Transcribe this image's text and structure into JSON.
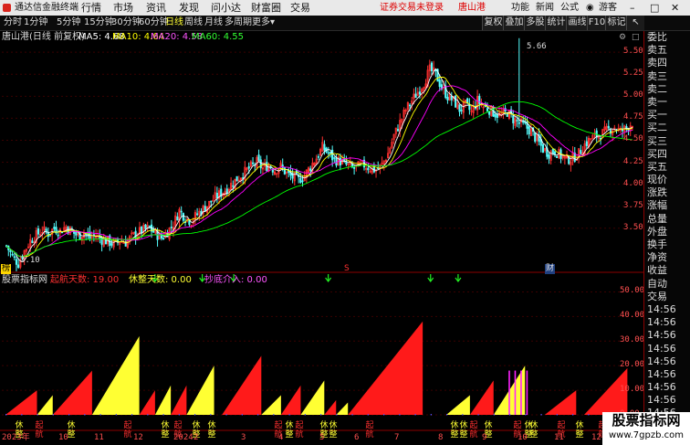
{
  "titlebar": {
    "app_name": "通达信金融终端",
    "menus": [
      "行情",
      "市场",
      "资讯",
      "发现",
      "问小达",
      "财富圈",
      "交易"
    ],
    "notice": "证券交易未登录",
    "stock_name": "唐山港",
    "right": [
      "功能",
      "新闻",
      "公式"
    ],
    "guest": "游客"
  },
  "toolbar": {
    "periods": [
      "分时",
      "1分钟",
      "5分钟",
      "15分钟",
      "30分钟",
      "60分钟",
      "日线",
      "周线",
      "月线",
      "多周期",
      "更多"
    ],
    "active_period": "日线",
    "right_buttons": [
      "复权",
      "叠加",
      "多股",
      "统计",
      "画线",
      "F10",
      "标记"
    ]
  },
  "main_legend": {
    "title": "唐山港(日线 前复权)",
    "ma5": "MA5: 4.68",
    "ma10": "MA10: 4.64",
    "ma20": "MA20: 4.58",
    "ma60": "MA60: 4.55"
  },
  "colors": {
    "ma5": "#ffffff",
    "ma10": "#ffff00",
    "ma20": "#ff00ff",
    "ma60": "#00ff00",
    "up": "#ff3030",
    "down": "#54ffff",
    "indicator_red": "#ff1a1a",
    "indicator_yellow": "#ffff33"
  },
  "price_axis": {
    "labels": [
      "5.50",
      "5.25",
      "5.00",
      "4.75",
      "4.50",
      "4.25",
      "4.00",
      "3.75",
      "3.50"
    ],
    "min": 3.02,
    "max": 5.72
  },
  "markers": {
    "high": "5.66",
    "low": "3.10",
    "s_tag": "S",
    "cai": "财",
    "left_tag": "榜"
  },
  "sub_legend": {
    "name": "股票指标网",
    "qihang": "起航天数: 19.00",
    "xiupan": "休整天数: 0.00",
    "chaodi": "抄底介入: 0.00"
  },
  "sub_axis": {
    "labels": [
      "50.00",
      "40.00",
      "30.00",
      "20.00",
      "10.00",
      "0.00"
    ],
    "min": 0,
    "max": 55
  },
  "right_panel": [
    "委比",
    "卖五",
    "卖四",
    "卖三",
    "卖二",
    "卖一",
    "买一",
    "买二",
    "买三",
    "买四",
    "买五",
    "现价",
    "涨跌",
    "涨幅",
    "总量",
    "外盘",
    "换手",
    "净资",
    "收益",
    "自动",
    "交易",
    "14:56",
    "14:56",
    "14:56",
    "14:56",
    "14:56",
    "14:56",
    "14:56",
    "14:56",
    "14:56",
    "14:56"
  ],
  "date_axis": [
    "2023年",
    "10",
    "11",
    "12",
    "2024",
    "2",
    "3",
    "4",
    "5",
    "6",
    "7",
    "8",
    "9",
    "10",
    "11",
    "12"
  ],
  "watermark": "股票指标网",
  "watermark_url": "www.7gpzb.com",
  "bottom_labels": [
    {
      "t": "休整",
      "c": "yellow"
    },
    {
      "t": "起航",
      "c": "red"
    },
    {
      "t": "休整",
      "c": "yellow"
    },
    {
      "t": "起航",
      "c": "red"
    },
    {
      "t": "休整",
      "c": "yellow"
    },
    {
      "t": "起航",
      "c": "red"
    },
    {
      "t": "休整",
      "c": "yellow"
    },
    {
      "t": "休整",
      "c": "yellow"
    },
    {
      "t": "起航",
      "c": "red"
    },
    {
      "t": "休整",
      "c": "yellow"
    },
    {
      "t": "起航",
      "c": "red"
    },
    {
      "t": "休整",
      "c": "yellow"
    },
    {
      "t": "休整",
      "c": "yellow"
    },
    {
      "t": "起航",
      "c": "red"
    },
    {
      "t": "休整",
      "c": "yellow"
    },
    {
      "t": "休整",
      "c": "yellow"
    },
    {
      "t": "起航",
      "c": "red"
    },
    {
      "t": "休整",
      "c": "yellow"
    },
    {
      "t": "起航",
      "c": "red"
    },
    {
      "t": "休整",
      "c": "yellow"
    },
    {
      "t": "休整",
      "c": "yellow"
    },
    {
      "t": "起航",
      "c": "red"
    },
    {
      "t": "休整",
      "c": "yellow"
    },
    {
      "t": "起航",
      "c": "red"
    }
  ],
  "chart_data": {
    "type": "candlestick+indicator",
    "close": [
      3.3,
      3.18,
      3.1,
      3.24,
      3.36,
      3.42,
      3.48,
      3.44,
      3.5,
      3.47,
      3.52,
      3.46,
      3.41,
      3.45,
      3.39,
      3.42,
      3.37,
      3.35,
      3.32,
      3.36,
      3.34,
      3.4,
      3.45,
      3.48,
      3.5,
      3.44,
      3.39,
      3.46,
      3.55,
      3.7,
      3.62,
      3.58,
      3.66,
      3.72,
      3.78,
      3.85,
      3.9,
      3.95,
      4.02,
      4.08,
      4.14,
      4.2,
      4.25,
      4.18,
      4.22,
      4.16,
      4.2,
      4.12,
      4.08,
      4.05,
      4.1,
      4.2,
      4.3,
      4.42,
      4.35,
      4.28,
      4.26,
      4.22,
      4.18,
      4.2,
      4.22,
      4.18,
      4.16,
      4.22,
      4.35,
      4.55,
      4.7,
      4.85,
      4.95,
      5.05,
      5.15,
      5.3,
      5.25,
      5.1,
      5.0,
      4.95,
      4.85,
      4.9,
      4.82,
      4.95,
      4.88,
      4.85,
      4.8,
      4.78,
      4.82,
      4.74,
      4.7,
      4.66,
      4.6,
      4.5,
      4.4,
      4.35,
      4.38,
      4.32,
      4.28,
      4.3,
      4.35,
      4.45,
      4.52,
      4.55,
      4.58,
      4.62,
      4.65,
      4.6,
      4.64,
      4.7
    ],
    "indicator": [
      {
        "c": "red",
        "s": 0,
        "e": 8,
        "max": 10
      },
      {
        "c": "yellow",
        "s": 8,
        "e": 12,
        "max": 8
      },
      {
        "c": "red",
        "s": 12,
        "e": 22,
        "max": 18
      },
      {
        "c": "yellow",
        "s": 22,
        "e": 34,
        "max": 32
      },
      {
        "c": "red",
        "s": 34,
        "e": 38,
        "max": 10
      },
      {
        "c": "yellow",
        "s": 38,
        "e": 42,
        "max": 12
      },
      {
        "c": "red",
        "s": 42,
        "e": 46,
        "max": 12
      },
      {
        "c": "yellow",
        "s": 46,
        "e": 53,
        "max": 20
      },
      {
        "c": "red",
        "s": 55,
        "e": 65,
        "max": 24
      },
      {
        "c": "yellow",
        "s": 65,
        "e": 70,
        "max": 8
      },
      {
        "c": "red",
        "s": 70,
        "e": 75,
        "max": 12
      },
      {
        "c": "yellow",
        "s": 75,
        "e": 81,
        "max": 14
      },
      {
        "c": "red",
        "s": 81,
        "e": 84,
        "max": 6
      },
      {
        "c": "yellow",
        "s": 84,
        "e": 87,
        "max": 5
      },
      {
        "c": "red",
        "s": 87,
        "e": 106,
        "max": 38
      },
      {
        "c": "yellow",
        "s": 112,
        "e": 118,
        "max": 8
      },
      {
        "c": "red",
        "s": 118,
        "e": 124,
        "max": 14
      },
      {
        "c": "yellow",
        "s": 124,
        "e": 132,
        "max": 20
      },
      {
        "c": "red",
        "s": 137,
        "e": 145,
        "max": 10
      },
      {
        "c": "red",
        "s": 147,
        "e": 158,
        "max": 19
      }
    ]
  }
}
